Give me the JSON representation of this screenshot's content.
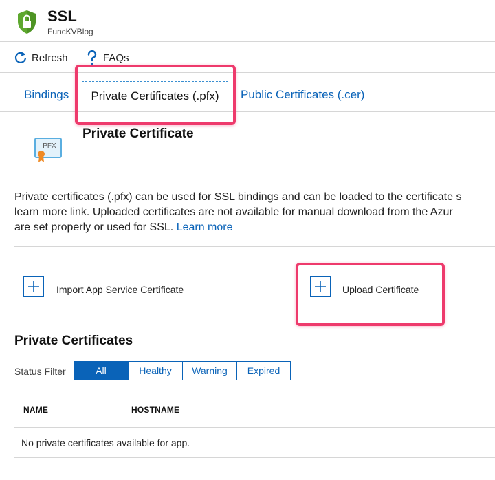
{
  "blade": {
    "title": "SSL",
    "subtitle": "FuncKVBlog",
    "icon": "shield-lock-icon",
    "icon_color": "#5ea82f"
  },
  "commands": [
    {
      "label": "Refresh",
      "icon": "refresh-icon"
    },
    {
      "label": "FAQs",
      "icon": "question-icon"
    }
  ],
  "tabs": [
    {
      "label": "Bindings",
      "selected": false
    },
    {
      "label": "Private Certificates (.pfx)",
      "selected": true
    },
    {
      "label": "Public Certificates (.cer)",
      "selected": false
    }
  ],
  "section": {
    "heading": "Private Certificate",
    "icon": "pfx-certificate-icon",
    "icon_text": "PFX"
  },
  "description": {
    "line1": "Private certificates (.pfx) can be used for SSL bindings and can be loaded to the certificate s",
    "line2": "learn more link. Uploaded certificates are not available for manual download from the Azur",
    "line3": "are set properly or used for SSL.",
    "link": "Learn more"
  },
  "actions": {
    "import_label": "Import App Service Certificate",
    "upload_label": "Upload Certificate"
  },
  "list": {
    "title": "Private Certificates",
    "filter_label": "Status Filter",
    "filters": [
      {
        "label": "All",
        "active": true
      },
      {
        "label": "Healthy",
        "active": false
      },
      {
        "label": "Warning",
        "active": false
      },
      {
        "label": "Expired",
        "active": false
      }
    ],
    "columns": [
      "NAME",
      "HOSTNAME"
    ],
    "empty_message": "No private certificates available for app."
  },
  "colors": {
    "accent": "#0a63b8",
    "highlight": "#ee3a6c"
  }
}
